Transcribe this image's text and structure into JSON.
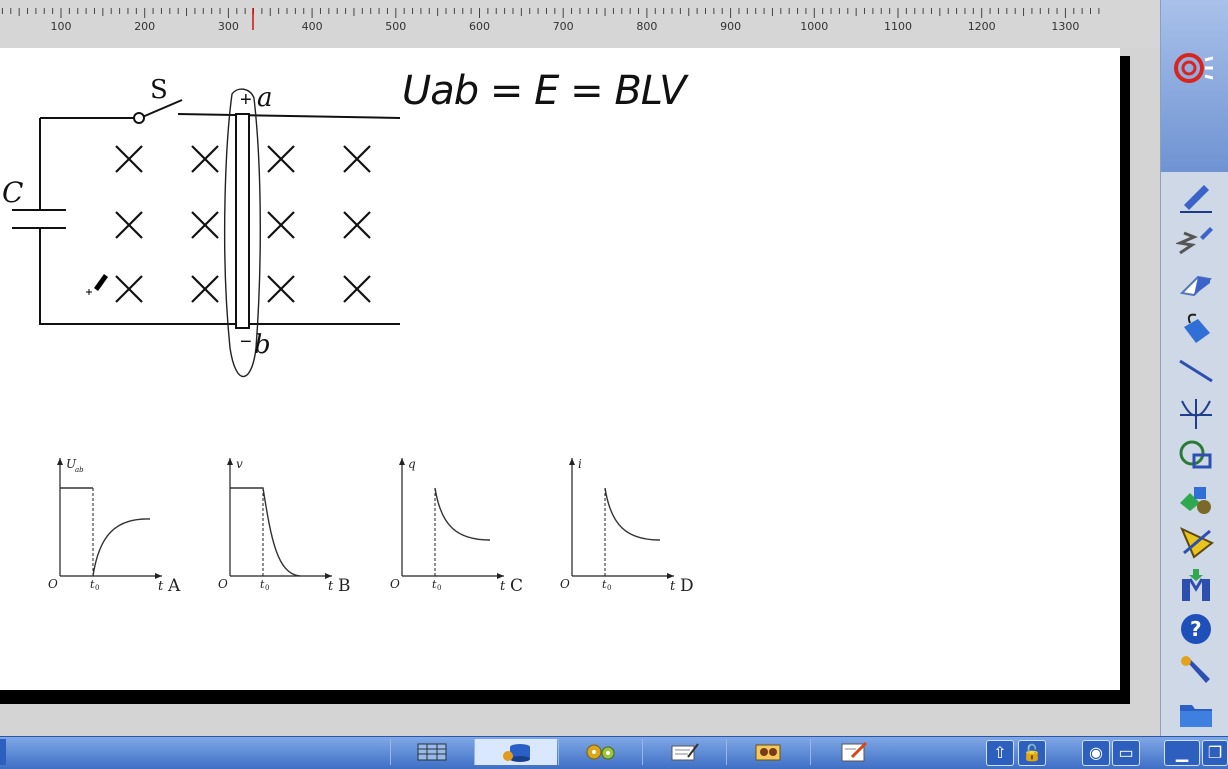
{
  "ruler": {
    "ticks": [
      "100",
      "200",
      "300",
      "400",
      "500",
      "600",
      "700",
      "800",
      "900",
      "1000",
      "1100",
      "1200",
      "1300"
    ]
  },
  "circuit": {
    "switch_label": "S",
    "capacitor_label": "C",
    "terminal_a": "a",
    "terminal_b": "b",
    "sign_plus": "+",
    "sign_minus": "−"
  },
  "equation": "Uab = E = BLV",
  "graphs": [
    {
      "letter": "A",
      "ylabel": "U",
      "ysub": "ab",
      "xlabel": "t",
      "origin": "O",
      "t0": "t",
      "t0sub": "0"
    },
    {
      "letter": "B",
      "ylabel": "v",
      "ysub": "",
      "xlabel": "t",
      "origin": "O",
      "t0": "t",
      "t0sub": "0"
    },
    {
      "letter": "C",
      "ylabel": "q",
      "ysub": "",
      "xlabel": "t",
      "origin": "O",
      "t0": "t",
      "t0sub": "0"
    },
    {
      "letter": "D",
      "ylabel": "i",
      "ysub": "",
      "xlabel": "t",
      "origin": "O",
      "t0": "t",
      "t0sub": "0"
    }
  ],
  "tools": [
    "pen-tool",
    "brush-tool",
    "eraser-tool",
    "fill-tool",
    "line-tool",
    "coordinate-tool",
    "shape-tool",
    "solid-tool",
    "ruler-tool",
    "insert-tool",
    "help-tool",
    "settings-tool",
    "folder-tool"
  ],
  "taskbar": {
    "buttons": [
      "table-icon",
      "database-icon",
      "gears-icon",
      "notes-icon",
      "media-icon",
      "edit-icon"
    ],
    "right": [
      "up-arrow-icon",
      "lock-icon",
      "capture-icon",
      "window-icon",
      "minimize-icon",
      "restore-icon"
    ]
  }
}
